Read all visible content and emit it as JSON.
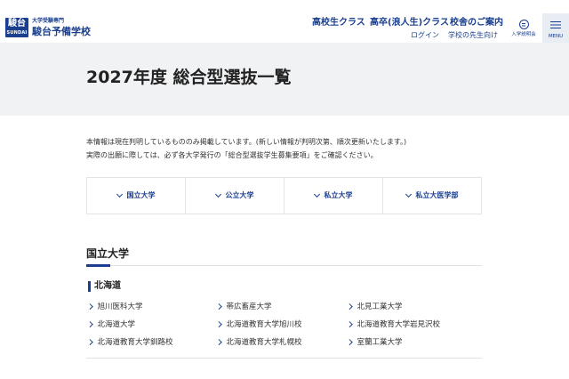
{
  "header": {
    "logo": {
      "kanji": "駿台",
      "en": "SUNDAI",
      "subtitle": "大学受験専門",
      "name": "駿台予備学校"
    },
    "nav": {
      "high_school": "高校生クラス",
      "graduate": "高卒(浪人生)クラス",
      "school_info": "校舎のご案内",
      "login": "ログイン",
      "teachers": "学校の先生向け"
    },
    "info_label": "入学説明会",
    "menu_label": "MENU"
  },
  "page": {
    "title": "2027年度 総合型選抜一覧"
  },
  "intro": [
    "本情報は現在判明しているもののみ掲載しています。(新しい情報が判明次第、順次更新いたします。)",
    "実際の出願に際しては、必ず各大学発行の「総合型選抜学生募集要項」をご確認ください。"
  ],
  "tabs": [
    "国立大学",
    "公立大学",
    "私立大学",
    "私立大医学部"
  ],
  "section": {
    "heading": "国立大学",
    "region": "北海道",
    "universities": [
      [
        "旭川医科大学",
        "帯広畜産大学",
        "北見工業大学"
      ],
      [
        "北海道大学",
        "北海道教育大学旭川校",
        "北海道教育大学岩見沢校"
      ],
      [
        "北海道教育大学釧路校",
        "北海道教育大学札幌校",
        "室蘭工業大学"
      ]
    ]
  },
  "colors": {
    "brand": "#1a3f8f",
    "band": "#f1f2f4"
  }
}
